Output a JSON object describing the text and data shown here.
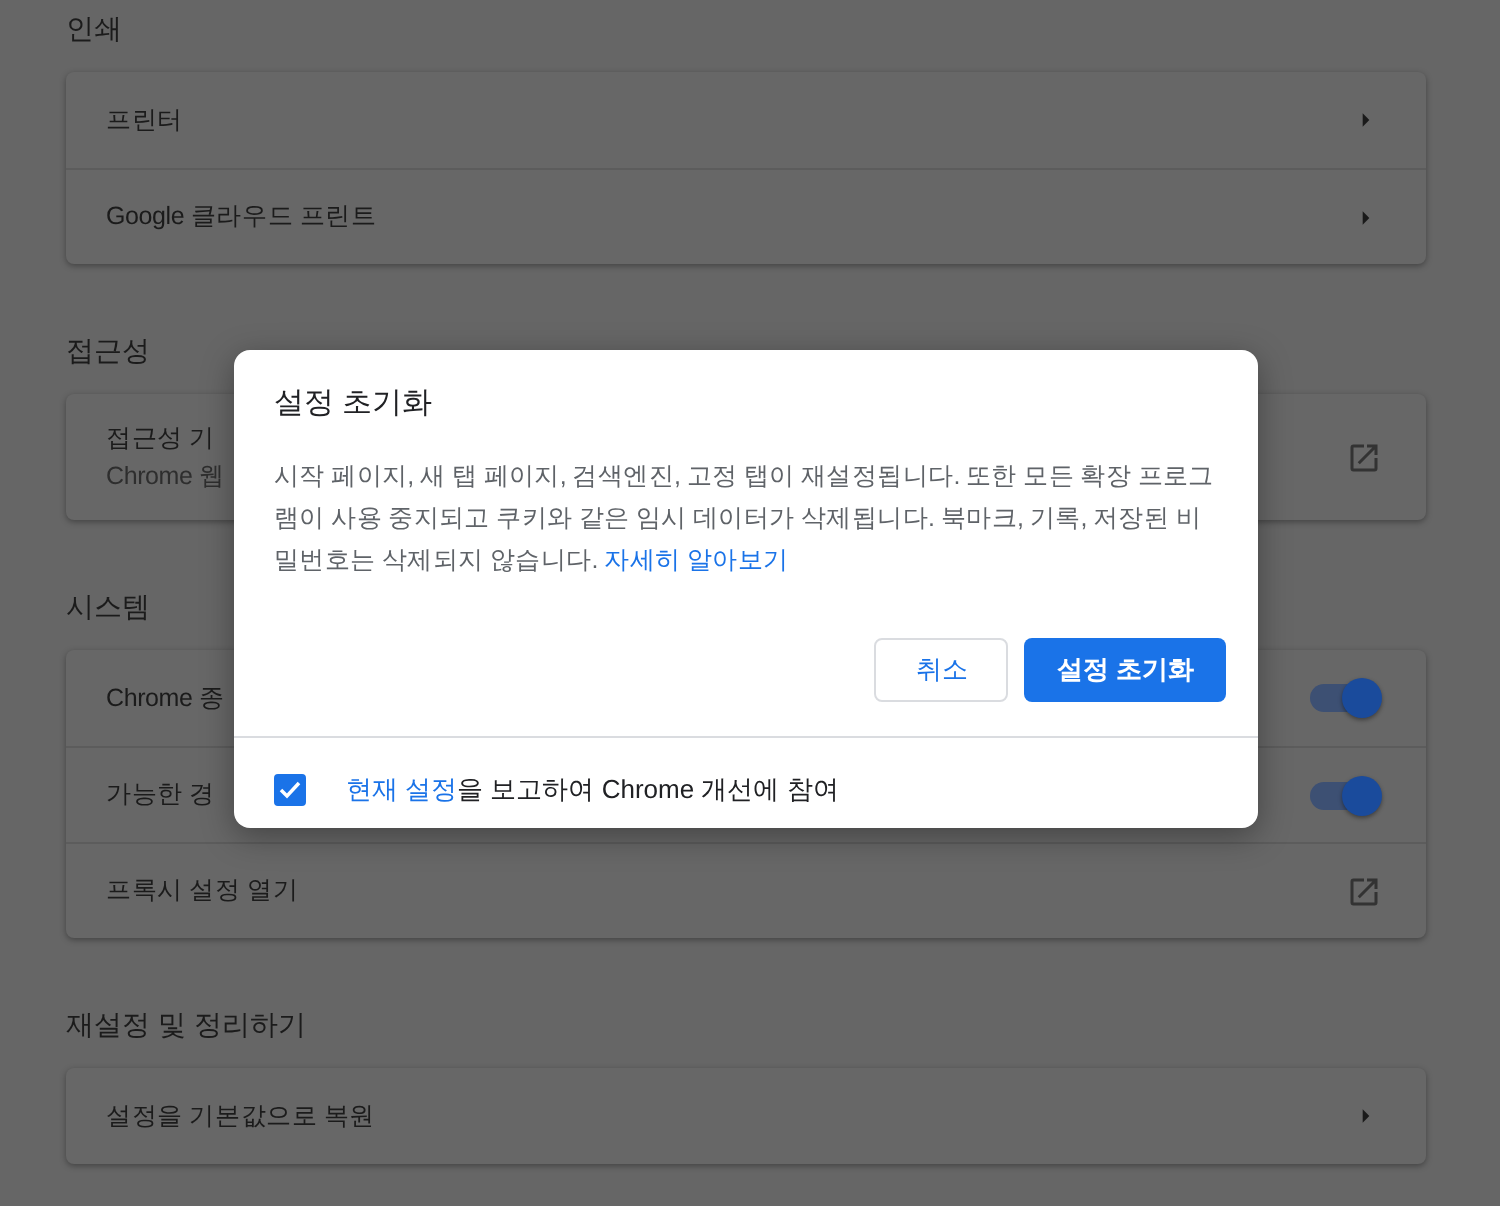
{
  "sections": [
    {
      "title": "인쇄",
      "rows": [
        {
          "kind": "arrow",
          "label": "프린터"
        },
        {
          "kind": "arrow",
          "label": "Google 클라우드 프린트"
        }
      ]
    },
    {
      "title": "접근성",
      "rows": [
        {
          "kind": "external",
          "label": "접근성 기",
          "sublabel": "Chrome 웹"
        }
      ]
    },
    {
      "title": "시스템",
      "rows": [
        {
          "kind": "toggle",
          "label": "Chrome 종",
          "on": true
        },
        {
          "kind": "toggle",
          "label": "가능한 경",
          "on": true
        },
        {
          "kind": "external",
          "label": "프록시 설정 열기"
        }
      ]
    },
    {
      "title": "재설정 및 정리하기",
      "rows": [
        {
          "kind": "arrow",
          "label": "설정을 기본값으로 복원"
        }
      ]
    }
  ],
  "dialog": {
    "title": "설정 초기화",
    "body": "시작 페이지, 새 탭 페이지, 검색엔진, 고정 탭이 재설정됩니다. 또한 모든 확장 프로그램이 사용 중지되고 쿠키와 같은 임시 데이터가 삭제됩니다. 북마크, 기록, 저장된 비밀번호는 삭제되지 않습니다.",
    "body_link": "자세히 알아보기",
    "cancel": "취소",
    "confirm": "설정 초기화",
    "report": {
      "checked": true,
      "link": "현재 설정",
      "text": "을 보고하여 Chrome 개선에 참여"
    }
  }
}
